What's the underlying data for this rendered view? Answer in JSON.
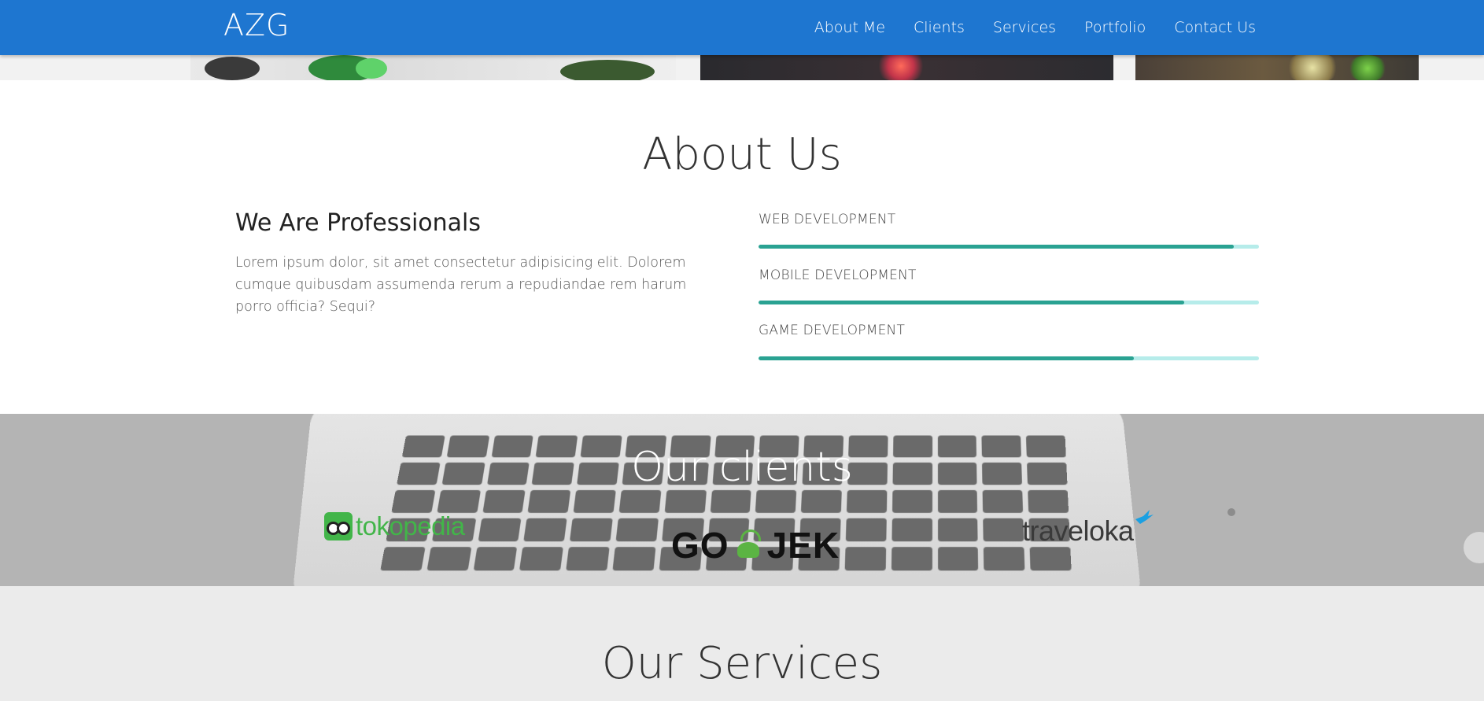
{
  "navbar": {
    "brand": "AZG",
    "links": [
      {
        "label": "About Me"
      },
      {
        "label": "Clients"
      },
      {
        "label": "Services"
      },
      {
        "label": "Portfolio"
      },
      {
        "label": "Contact Us"
      }
    ],
    "background_color": "#1e76d0"
  },
  "about": {
    "title": "About Us",
    "heading": "We Are Professionals",
    "text": "Lorem ipsum dolor, sit amet consectetur adipisicing elit. Dolorem cumque quibusdam assumenda rerum a repudiandae rem harum porro officia? Sequi?",
    "skills": [
      {
        "label": "WEB DEVELOPMENT",
        "progress_percent": 95
      },
      {
        "label": "MOBILE DEVELOPMENT",
        "progress_percent": 85
      },
      {
        "label": "GAME DEVELOPMENT",
        "progress_percent": 75
      }
    ],
    "bar_fill_color": "#2aa292",
    "bar_track_color": "#b6ecea"
  },
  "clients": {
    "title": "Our clients",
    "logos": [
      {
        "name": "tokopedia",
        "color": "#42b549"
      },
      {
        "name_left": "GO",
        "name_right": "JEK",
        "color": "#5bb443"
      },
      {
        "name": "traveloka",
        "color": "#1ba0e2"
      }
    ]
  },
  "services": {
    "title": "Our Services"
  }
}
